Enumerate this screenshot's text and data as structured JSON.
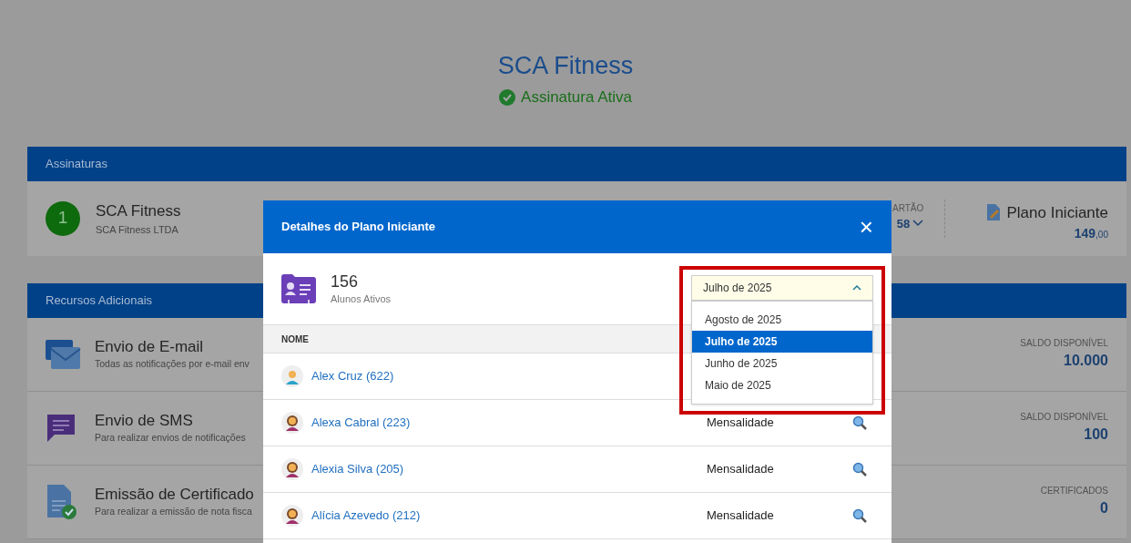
{
  "page": {
    "title": "SCA Fitness",
    "status": "Assinatura Ativa"
  },
  "subscriptions": {
    "header": "Assinaturas",
    "card": {
      "number": "1",
      "name": "SCA Fitness",
      "company": "SCA Fitness LTDA",
      "partial_label": "ARTÃO",
      "partial_value": "58",
      "plan_name": "Plano Iniciante",
      "plan_price": "149",
      "plan_cents": ",00"
    }
  },
  "resources": {
    "header": "Recursos Adicionais",
    "items": [
      {
        "kind": "email",
        "title": "Envio de E-mail",
        "description": "Todas as notificações por e-mail env",
        "label": "SALDO DISPONÍVEL",
        "value": "10.000"
      },
      {
        "kind": "sms",
        "title": "Envio de SMS",
        "description": "Para realizar envios de notificações",
        "label": "SALDO DISPONÍVEL",
        "value": "100"
      },
      {
        "kind": "certificate",
        "title": "Emissão de Certificado",
        "description": "Para realizar a emissão de nota fisca",
        "label": "CERTIFICADOS",
        "value": "0"
      }
    ]
  },
  "modal": {
    "title": "Detalhes do Plano Iniciante",
    "close": "×",
    "count": "156",
    "count_label": "Alunos Ativos",
    "column_name": "NOME",
    "rows": [
      {
        "name": "Alex Cruz (622)",
        "kind": "male"
      },
      {
        "name": "Alexa Cabral (223)",
        "kind": "female",
        "type": "Mensalidade"
      },
      {
        "name": "Alexia Silva (205)",
        "kind": "female",
        "type": "Mensalidade"
      },
      {
        "name": "Alícia Azevedo (212)",
        "kind": "female",
        "type": "Mensalidade"
      }
    ],
    "month_select": {
      "value": "Julho de 2025",
      "expanded": true,
      "options": [
        {
          "label": "Agosto de 2025",
          "selected": false
        },
        {
          "label": "Julho de 2025",
          "selected": true
        },
        {
          "label": "Junho de 2025",
          "selected": false
        },
        {
          "label": "Maio de 2025",
          "selected": false
        }
      ]
    }
  }
}
